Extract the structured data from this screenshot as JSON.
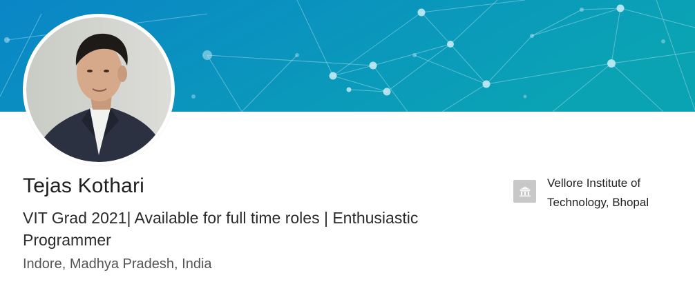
{
  "profile": {
    "name": "Tejas Kothari",
    "headline": "VIT Grad 2021| Available for full time roles | Enthusiastic Programmer",
    "location": "Indore, Madhya Pradesh, India",
    "education": {
      "school": "Vellore Institute of Technology, Bhopal",
      "logo_icon": "school-building-icon"
    },
    "avatar_icon": "profile-photo"
  },
  "banner": {
    "style": "network-nodes",
    "color_start": "#0a86c7",
    "color_end": "#0aa3b4"
  }
}
